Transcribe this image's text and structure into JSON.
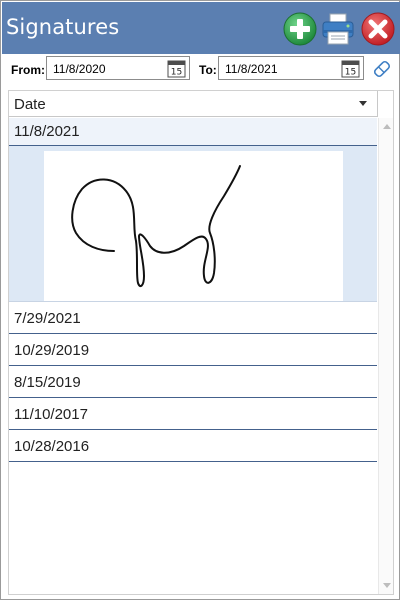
{
  "header": {
    "title": "Signatures",
    "buttons": {
      "add": {
        "icon": "plus-circle-icon",
        "color": "#2ea24e"
      },
      "print": {
        "icon": "printer-icon",
        "color": "#3f7fc4"
      },
      "close": {
        "icon": "close-circle-icon",
        "color": "#d9343a"
      }
    },
    "background": "#5b7fb1"
  },
  "filter": {
    "from_label": "From:",
    "from_value": "11/8/2020",
    "to_label": "To:",
    "to_value": "11/8/2021",
    "calendar_day": "15",
    "clear_icon": "eraser-icon"
  },
  "grid": {
    "column_header": "Date",
    "rows": [
      {
        "date": "11/8/2021",
        "selected": true,
        "has_signature": true
      },
      {
        "date": "7/29/2021"
      },
      {
        "date": "10/29/2019"
      },
      {
        "date": "8/15/2019"
      },
      {
        "date": "11/10/2017"
      },
      {
        "date": "10/28/2016"
      }
    ],
    "row_divider_color": "#44618c",
    "selected_color": "#dde8f5"
  }
}
